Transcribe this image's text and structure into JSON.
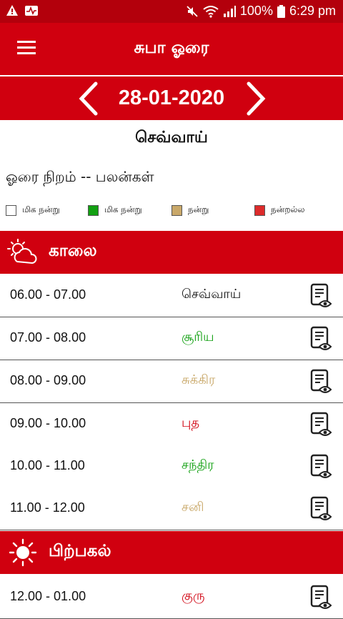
{
  "status": {
    "battery": "100%",
    "time": "6:29 pm"
  },
  "header": {
    "title": "சுபா ஓரை"
  },
  "date": "28-01-2020",
  "day": "செவ்வாய்",
  "hora_title": "ஓரை நிறம் -- பலன்கள்",
  "legend": [
    {
      "label": "மிக நன்று",
      "color": "#ffffff"
    },
    {
      "label": "மிக நன்று",
      "color": "#12a012"
    },
    {
      "label": "நன்று",
      "color": "#c9a869"
    },
    {
      "label": "நன்றல்ல",
      "color": "#dd2b2b"
    }
  ],
  "sections": [
    {
      "title": "காலை",
      "icon": "partly-cloudy-icon"
    },
    {
      "title": "பிற்பகல்",
      "icon": "sun-icon"
    }
  ],
  "rows": [
    {
      "time": "06.00 - 07.00",
      "planet": "செவ்வாய்",
      "color": "#111111"
    },
    {
      "time": "07.00 - 08.00",
      "planet": "சூரிய",
      "color": "#12a012"
    },
    {
      "time": "08.00 - 09.00",
      "planet": "சுக்கிர",
      "color": "#c9a869"
    },
    {
      "time": "09.00 - 10.00",
      "planet": "புத",
      "color": "#d0000f"
    },
    {
      "time": "10.00 - 11.00",
      "planet": "சந்திர",
      "color": "#12a012"
    },
    {
      "time": "11.00 - 12.00",
      "planet": "சனி",
      "color": "#c9a869"
    },
    {
      "time": "12.00 - 01.00",
      "planet": "குரு",
      "color": "#d0000f"
    }
  ]
}
